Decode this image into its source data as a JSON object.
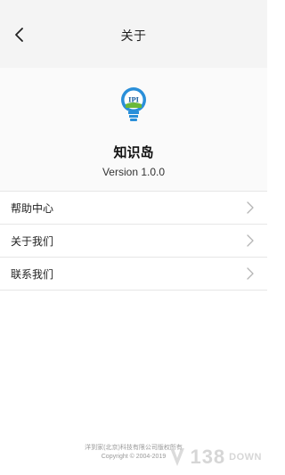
{
  "header": {
    "title": "关于"
  },
  "app": {
    "name": "知识岛",
    "version": "Version 1.0.0",
    "logo_text": "IPI"
  },
  "menu": {
    "items": [
      {
        "label": "帮助中心"
      },
      {
        "label": "关于我们"
      },
      {
        "label": "联系我们"
      }
    ]
  },
  "footer": {
    "company": "洋到家(北京)科技有限公司版权所有",
    "copyright": "Copyright © 2004-2019"
  },
  "watermark": {
    "number": "138",
    "suffix": "DOWN"
  },
  "colors": {
    "header_bg": "#f4f4f4",
    "logo_blue": "#2a8fd9",
    "divider": "#e6e6e6"
  }
}
